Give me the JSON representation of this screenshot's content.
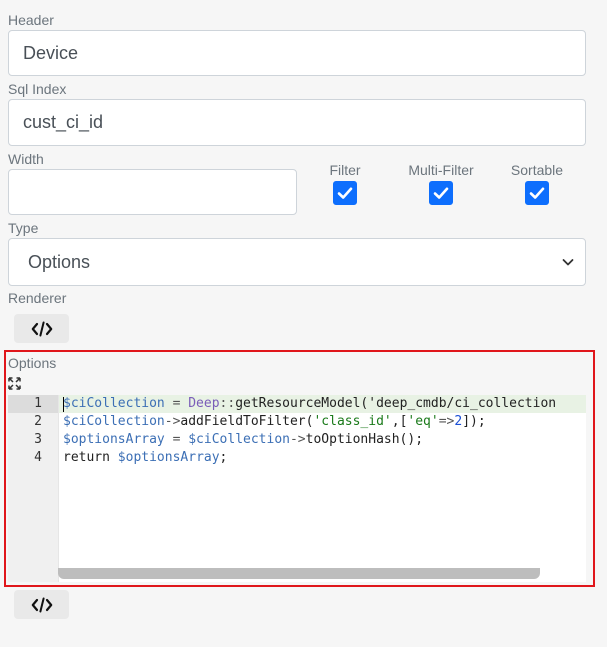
{
  "fields": {
    "header": {
      "label": "Header",
      "value": "Device"
    },
    "sql_index": {
      "label": "Sql Index",
      "value": "cust_ci_id"
    },
    "width": {
      "label": "Width",
      "value": ""
    },
    "type": {
      "label": "Type",
      "value": "Options"
    },
    "renderer": {
      "label": "Renderer"
    },
    "options": {
      "label": "Options"
    }
  },
  "checkboxes": {
    "filter": {
      "label": "Filter",
      "checked": true
    },
    "multi_filter": {
      "label": "Multi-Filter",
      "checked": true
    },
    "sortable": {
      "label": "Sortable",
      "checked": true
    }
  },
  "editor": {
    "line_numbers": [
      "1",
      "2",
      "3",
      "4"
    ],
    "lines": [
      "$ciCollection = Deep::getResourceModel('deep_cmdb/ci_collection",
      "$ciCollection->addFieldToFilter('class_id',['eq'=>2]);",
      "$optionsArray = $ciCollection->toOptionHash();",
      "return $optionsArray;"
    ]
  },
  "icons": {
    "code": "code-icon",
    "expand": "expand-icon",
    "chevron": "chevron-down-icon"
  },
  "colors": {
    "accent": "#0d6efd",
    "highlight_border": "#e0161b"
  }
}
